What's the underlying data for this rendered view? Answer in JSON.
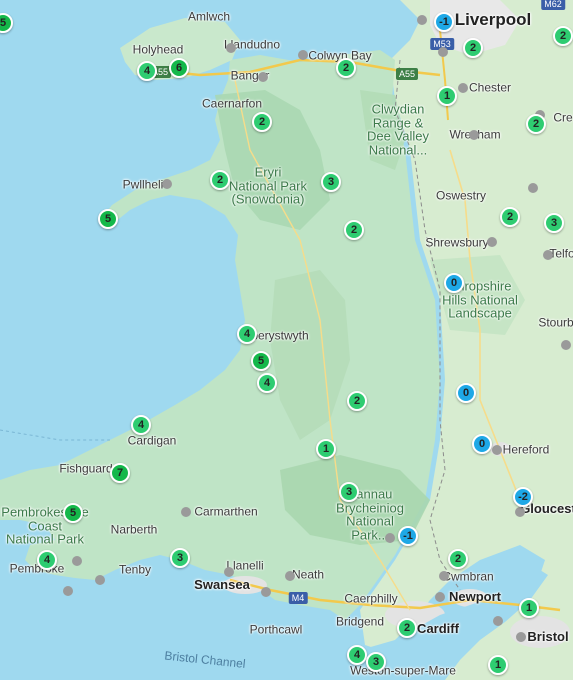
{
  "map": {
    "place_labels": [
      {
        "id": "amlwch",
        "text": "Amlwch",
        "kind": "town"
      },
      {
        "id": "holyhead",
        "text": "Holyhead",
        "kind": "town"
      },
      {
        "id": "llandudno",
        "text": "Llandudno",
        "kind": "town"
      },
      {
        "id": "colwyn-bay",
        "text": "Colwyn Bay",
        "kind": "town"
      },
      {
        "id": "liverpool",
        "text": "Liverpool",
        "kind": "big"
      },
      {
        "id": "bangor",
        "text": "Bangor",
        "kind": "town"
      },
      {
        "id": "chester",
        "text": "Chester",
        "kind": "town"
      },
      {
        "id": "caernarfon",
        "text": "Caernarfon",
        "kind": "town"
      },
      {
        "id": "clwydian",
        "text": "Clwydian\nRange &\nDee Valley\nNational...",
        "kind": "park"
      },
      {
        "id": "cre",
        "text": "Cre",
        "kind": "town"
      },
      {
        "id": "wrexham",
        "text": "Wrexham",
        "kind": "town"
      },
      {
        "id": "pwllheli",
        "text": "Pwllheli",
        "kind": "town"
      },
      {
        "id": "eryri",
        "text": "Eryri\nNational Park\n(Snowdonia)",
        "kind": "park"
      },
      {
        "id": "oswestry",
        "text": "Oswestry",
        "kind": "town"
      },
      {
        "id": "shrewsbury",
        "text": "Shrewsbury",
        "kind": "town"
      },
      {
        "id": "telfo",
        "text": "Telfo",
        "kind": "town"
      },
      {
        "id": "shropshire",
        "text": "Shropshire\nHills National\nLandscape",
        "kind": "park"
      },
      {
        "id": "stourb",
        "text": "Stourb",
        "kind": "town"
      },
      {
        "id": "aberystwyth",
        "text": "Aberystwyth",
        "kind": "town"
      },
      {
        "id": "cardigan",
        "text": "Cardigan",
        "kind": "town"
      },
      {
        "id": "hereford",
        "text": "Hereford",
        "kind": "town"
      },
      {
        "id": "fishguard",
        "text": "Fishguard",
        "kind": "town"
      },
      {
        "id": "bannau",
        "text": "Bannau\nBrycheiniog\nNational\nPark...",
        "kind": "park"
      },
      {
        "id": "gloucester",
        "text": "Gloucest",
        "kind": "city"
      },
      {
        "id": "pembrokeshire",
        "text": "Pembrokeshire\nCoast\nNational Park",
        "kind": "park"
      },
      {
        "id": "narberth",
        "text": "Narberth",
        "kind": "town"
      },
      {
        "id": "carmarthen",
        "text": "Carmarthen",
        "kind": "town"
      },
      {
        "id": "pembroke",
        "text": "Pembroke",
        "kind": "town"
      },
      {
        "id": "tenby",
        "text": "Tenby",
        "kind": "town"
      },
      {
        "id": "llanelli",
        "text": "Llanelli",
        "kind": "town"
      },
      {
        "id": "cwmbran",
        "text": "Cwmbran",
        "kind": "town"
      },
      {
        "id": "swansea",
        "text": "Swansea",
        "kind": "city"
      },
      {
        "id": "neath",
        "text": "Neath",
        "kind": "town"
      },
      {
        "id": "newport",
        "text": "Newport",
        "kind": "city"
      },
      {
        "id": "caerphilly",
        "text": "Caerphilly",
        "kind": "town"
      },
      {
        "id": "porthcawl",
        "text": "Porthcawl",
        "kind": "town"
      },
      {
        "id": "bridgend",
        "text": "Bridgend",
        "kind": "town"
      },
      {
        "id": "cardiff",
        "text": "Cardiff",
        "kind": "city"
      },
      {
        "id": "bristol",
        "text": "Bristol",
        "kind": "city"
      },
      {
        "id": "bristol-channel",
        "text": "Bristol Channel",
        "kind": "sea"
      },
      {
        "id": "weston",
        "text": "Weston-super-Mare",
        "kind": "town"
      }
    ],
    "road_shields": [
      {
        "id": "a55",
        "text": "A55",
        "kind": "a"
      },
      {
        "id": "a55-west",
        "text": "A55",
        "kind": "a"
      },
      {
        "id": "m53",
        "text": "M53",
        "kind": "m"
      },
      {
        "id": "m62",
        "text": "M62",
        "kind": "m"
      },
      {
        "id": "m4",
        "text": "M4",
        "kind": "m"
      }
    ],
    "markers": [
      {
        "id": "m-edge-nw",
        "value": "5",
        "color": "#14b84a"
      },
      {
        "id": "m-liverpool",
        "value": "-1",
        "color": "#1ea8e6"
      },
      {
        "id": "m-wirral",
        "value": "2",
        "color": "#2ecc71"
      },
      {
        "id": "m-ne-edge",
        "value": "2",
        "color": "#2ecc71"
      },
      {
        "id": "m-holyhead-a",
        "value": "4",
        "color": "#2ecc71"
      },
      {
        "id": "m-holyhead-b",
        "value": "6",
        "color": "#14b84a"
      },
      {
        "id": "m-colwyn",
        "value": "2",
        "color": "#2ecc71"
      },
      {
        "id": "m-chester",
        "value": "1",
        "color": "#2ecc71"
      },
      {
        "id": "m-snowdon",
        "value": "2",
        "color": "#2ecc71"
      },
      {
        "id": "m-crewe",
        "value": "2",
        "color": "#2ecc71"
      },
      {
        "id": "m-porthmadog",
        "value": "2",
        "color": "#2ecc71"
      },
      {
        "id": "m-eryri",
        "value": "3",
        "color": "#2ecc71"
      },
      {
        "id": "m-llyn",
        "value": "5",
        "color": "#14b84a"
      },
      {
        "id": "m-bala",
        "value": "2",
        "color": "#2ecc71"
      },
      {
        "id": "m-shrop-a",
        "value": "2",
        "color": "#2ecc71"
      },
      {
        "id": "m-telford",
        "value": "3",
        "color": "#2ecc71"
      },
      {
        "id": "m-shropshire",
        "value": "0",
        "color": "#1ea8e6"
      },
      {
        "id": "m-aber",
        "value": "4",
        "color": "#2ecc71"
      },
      {
        "id": "m-aber-b",
        "value": "5",
        "color": "#14b84a"
      },
      {
        "id": "m-aber-c",
        "value": "4",
        "color": "#2ecc71"
      },
      {
        "id": "m-ludlow",
        "value": "0",
        "color": "#1ea8e6"
      },
      {
        "id": "m-rhayader",
        "value": "2",
        "color": "#2ecc71"
      },
      {
        "id": "m-cardigan",
        "value": "4",
        "color": "#2ecc71"
      },
      {
        "id": "m-hereford",
        "value": "0",
        "color": "#1ea8e6"
      },
      {
        "id": "m-builth",
        "value": "1",
        "color": "#2ecc71"
      },
      {
        "id": "m-fishguard",
        "value": "7",
        "color": "#14b84a"
      },
      {
        "id": "m-gloucester",
        "value": "-2",
        "color": "#1ea8e6"
      },
      {
        "id": "m-bannau",
        "value": "3",
        "color": "#2ecc71"
      },
      {
        "id": "m-pembs",
        "value": "5",
        "color": "#14b84a"
      },
      {
        "id": "m-abergavenny",
        "value": "-1",
        "color": "#1ea8e6"
      },
      {
        "id": "m-pembroke",
        "value": "4",
        "color": "#2ecc71"
      },
      {
        "id": "m-gower",
        "value": "3",
        "color": "#2ecc71"
      },
      {
        "id": "m-cwmbran",
        "value": "2",
        "color": "#2ecc71"
      },
      {
        "id": "m-chepstow",
        "value": "1",
        "color": "#2ecc71"
      },
      {
        "id": "m-cardiff",
        "value": "2",
        "color": "#2ecc71"
      },
      {
        "id": "m-weston-a",
        "value": "4",
        "color": "#2ecc71"
      },
      {
        "id": "m-weston-b",
        "value": "3",
        "color": "#2ecc71"
      },
      {
        "id": "m-somerset",
        "value": "1",
        "color": "#2ecc71"
      }
    ]
  }
}
